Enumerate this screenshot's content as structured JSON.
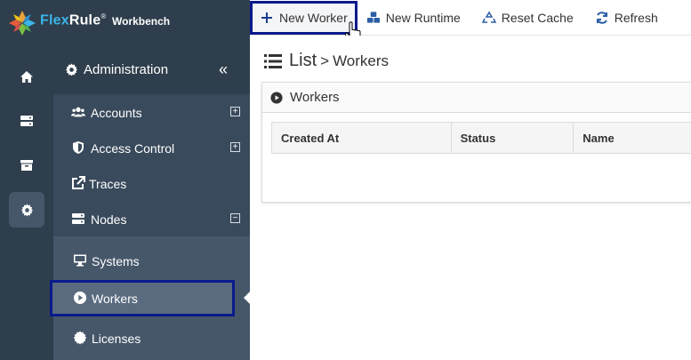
{
  "brand": {
    "name_part1": "Flex",
    "name_part2": "Rule",
    "registered": "®",
    "product": "Workbench"
  },
  "toolbar": {
    "new_worker": "New Worker",
    "new_runtime": "New Runtime",
    "reset_cache": "Reset Cache",
    "refresh": "Refresh"
  },
  "rail": {
    "items": [
      "home-icon",
      "server-icon",
      "archive-icon",
      "gear-icon"
    ],
    "active_index": 3
  },
  "menu": {
    "title": "Administration",
    "collapse_label": "«",
    "items": [
      {
        "label": "Accounts",
        "icon": "users-icon",
        "toggle": "+"
      },
      {
        "label": "Access Control",
        "icon": "shield-icon",
        "toggle": "+"
      },
      {
        "label": "Traces",
        "icon": "external-link-icon",
        "toggle": ""
      },
      {
        "label": "Nodes",
        "icon": "server-icon",
        "toggle": "−"
      }
    ],
    "subitems": [
      {
        "label": "Systems",
        "icon": "desktop-icon"
      },
      {
        "label": "Workers",
        "icon": "play-circle-icon"
      },
      {
        "label": "Licenses",
        "icon": "certificate-icon"
      }
    ],
    "selected_subitem": "Workers"
  },
  "main": {
    "breadcrumb_root": "List",
    "breadcrumb_sep": ">",
    "breadcrumb_page": "Workers",
    "panel_title": "Workers",
    "columns": [
      "Created At",
      "Status",
      "Name"
    ]
  },
  "colors": {
    "sidebar_dark": "#2f3e4c",
    "sidebar_mid": "#394a5c",
    "submenu": "#46576a",
    "highlight_border": "#0a1a8c",
    "accent_blue": "#1a3d8f"
  }
}
